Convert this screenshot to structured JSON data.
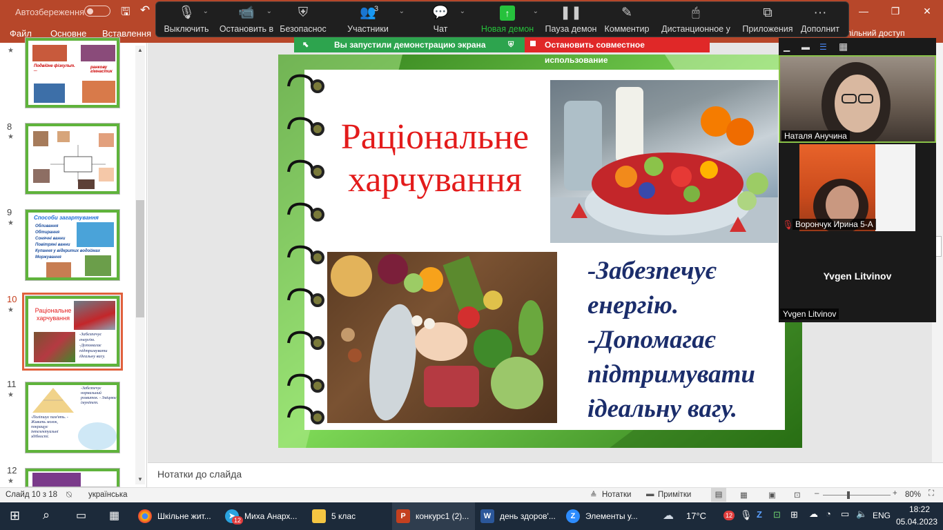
{
  "powerpoint": {
    "autosave_label": "Автозбереження",
    "tabs": [
      "Файл",
      "Основне",
      "Вставлення"
    ],
    "share_partial": "пільний доступ",
    "window_controls": [
      "—",
      "❐",
      "✕"
    ]
  },
  "zoom_toolbar": {
    "items": [
      {
        "label": "Выключить",
        "icon": "microphone-icon"
      },
      {
        "label": "Остановить в",
        "icon": "video-camera-icon"
      },
      {
        "label": "Безопаснос",
        "icon": "shield-icon"
      },
      {
        "label": "Участники",
        "icon": "participants-icon",
        "badge": "3"
      },
      {
        "label": "Чат",
        "icon": "chat-icon"
      },
      {
        "label": "Новая демон",
        "icon": "share-screen-icon"
      },
      {
        "label": "Пауза демон",
        "icon": "pause-icon"
      },
      {
        "label": "Комментир",
        "icon": "pen-icon"
      },
      {
        "label": "Дистанционное у",
        "icon": "mouse-icon"
      },
      {
        "label": "Приложения",
        "icon": "apps-icon"
      },
      {
        "label": "Дополнит",
        "icon": "more-icon"
      }
    ],
    "sharing_banner": "Вы запустили демонстрацию экрана",
    "stop_share": "Остановить совместное использование"
  },
  "thumbnails": [
    {
      "num": "",
      "title": ""
    },
    {
      "num": "8",
      "title": ""
    },
    {
      "num": "9",
      "title": "Способи загартування"
    },
    {
      "num": "10",
      "title": "Раціональне харчування"
    },
    {
      "num": "11",
      "title": ""
    },
    {
      "num": "12",
      "title": ""
    }
  ],
  "thumb_texts": {
    "t7a": "Подвійне фізкульт. ...",
    "t7b": "ранкову гімнастик",
    "t9_items": [
      "Обливання",
      "Обтирання",
      "Сонячні ванни",
      "Повітряні ванни",
      "Купання у відкритих водоймах",
      "Моржування"
    ],
    "t10_bul": "-Забезпечує енергію. -Допомагає підтримувати ідеальну вагу.",
    "t11_a": "-Забезпечує нормальний розвиток. - Зміцнює імунітет.",
    "t11_b": "-Поліпшує пам'ять. - Живить мозок, покращує інтелектуальні здібності."
  },
  "slide": {
    "title": "Раціональне харчування",
    "bullets": [
      "-Забезпечує енергію.",
      "-Допомагає підтримувати ідеальну вагу."
    ]
  },
  "notes_placeholder": "Нотатки до слайда",
  "status": {
    "slide_info": "Слайд 10 з 18",
    "language": "українська",
    "notes": "Нотатки",
    "comments": "Примітки",
    "zoom": "80%"
  },
  "zoom_participants": [
    {
      "name": "Наталя Анучина",
      "muted": false
    },
    {
      "name": "Ворончук Ирина 5-А",
      "muted": true
    },
    {
      "name": "Yvgen Litvinov",
      "muted": false
    }
  ],
  "taskbar": {
    "apps": [
      {
        "label": "Шкільне жит...",
        "icon": "chrome-icon"
      },
      {
        "label": "Миха Анарх...",
        "icon": "telegram-icon",
        "badge": "12"
      },
      {
        "label": "5 клас",
        "icon": "folder-icon"
      },
      {
        "label": "конкурс1 (2)...",
        "icon": "powerpoint-icon"
      },
      {
        "label": "день здоров'...",
        "icon": "word-icon"
      },
      {
        "label": "Элементы у...",
        "icon": "zoom-icon"
      }
    ],
    "weather": "17°C",
    "tray_badge": "12",
    "lang": "ENG",
    "time": "18:22",
    "date": "05.04.2023"
  }
}
